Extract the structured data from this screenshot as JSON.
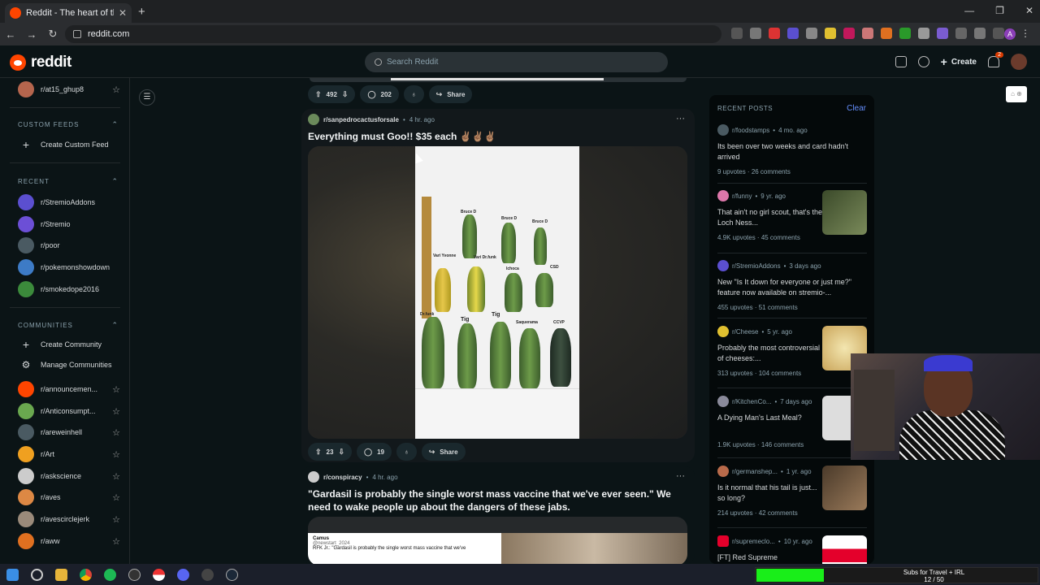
{
  "browser": {
    "tab_title": "Reddit - The heart of the intern",
    "new_tab": "+",
    "url": "reddit.com",
    "profile_initial": "A"
  },
  "header": {
    "logo_text": "reddit",
    "search_placeholder": "Search Reddit",
    "create_label": "Create",
    "notif_count": "2"
  },
  "sidebar": {
    "top_item": "r/at15_ghup8",
    "custom_feeds_head": "CUSTOM FEEDS",
    "create_custom_feed": "Create Custom Feed",
    "recent_head": "RECENT",
    "recent": [
      "r/StremioAddons",
      "r/Stremio",
      "r/poor",
      "r/pokemonshowdown",
      "r/smokedope2016"
    ],
    "communities_head": "COMMUNITIES",
    "create_community": "Create Community",
    "manage_communities": "Manage Communities",
    "communities": [
      "r/announcemen...",
      "r/Anticonsumpt...",
      "r/areweinhell",
      "r/Art",
      "r/askscience",
      "r/aves",
      "r/avescirclejerk",
      "r/aww"
    ]
  },
  "feed": {
    "prev_actions": {
      "votes": "492",
      "comments": "202",
      "share": "Share"
    },
    "post1": {
      "subreddit": "r/sanpedrocactusforsale",
      "time": "4 hr. ago",
      "title": "Everything must Goo!! $35 each ✌🏽✌🏽✌🏽",
      "votes": "23",
      "comments": "19",
      "share": "Share",
      "labels": [
        "Bruce D",
        "Bruce D",
        "Bruce D",
        "Vari Yvonne",
        "Vari Dr.funk",
        "Ichoca",
        "CSD",
        "Dr.funk",
        "Tig",
        "Tig",
        "Saquerama",
        "CCVP"
      ]
    },
    "post2": {
      "subreddit": "r/conspiracy",
      "time": "4 hr. ago",
      "title": "\"Gardasil is probably the single worst mass vaccine that we've ever seen.\" We need to wake people up about the dangers of these jabs.",
      "tweet_name": "Camus",
      "tweet_handle": "@newstart_2024",
      "tweet_text": "RFK Jr.: \"Gardasil is probably the single worst mass vaccine that we've"
    }
  },
  "recent_posts": {
    "head": "RECENT POSTS",
    "clear": "Clear",
    "items": [
      {
        "sub": "r/foodstamps",
        "time": "4 mo. ago",
        "title": "Its been over two weeks and card hadn't arrived",
        "upvotes": "9 upvotes",
        "comments": "26 comments"
      },
      {
        "sub": "r/funny",
        "time": "9 yr. ago",
        "title": "That ain't no girl scout, that's the Loch Ness...",
        "upvotes": "4.9K upvotes",
        "comments": "45 comments"
      },
      {
        "sub": "r/StremioAddons",
        "time": "3 days ago",
        "title": "New \"Is It down for everyone or just me?\" feature now available on stremio-...",
        "upvotes": "455 upvotes",
        "comments": "51 comments"
      },
      {
        "sub": "r/Cheese",
        "time": "5 yr. ago",
        "title": "Probably the most controversial of cheeses:...",
        "upvotes": "313 upvotes",
        "comments": "104 comments"
      },
      {
        "sub": "r/KitchenCo...",
        "time": "7 days ago",
        "title": "A Dying Man's Last Meal?",
        "upvotes": "1.9K upvotes",
        "comments": "146 comments"
      },
      {
        "sub": "r/germanshep...",
        "time": "1 yr. ago",
        "title": "Is it normal that his tail is just... so long?",
        "upvotes": "214 upvotes",
        "comments": "42 comments"
      },
      {
        "sub": "r/supremeclo...",
        "time": "10 yr. ago",
        "title": "[FT] Red Supreme",
        "upvotes": "",
        "comments": ""
      }
    ]
  },
  "overlay": {
    "subs_label": "Subs for Travel + IRL",
    "subs_count": "12 / 50",
    "subs_fraction": 0.24
  },
  "colors": {
    "brand": "#ff4500",
    "link": "#648efc",
    "progress": "#19ee19"
  }
}
